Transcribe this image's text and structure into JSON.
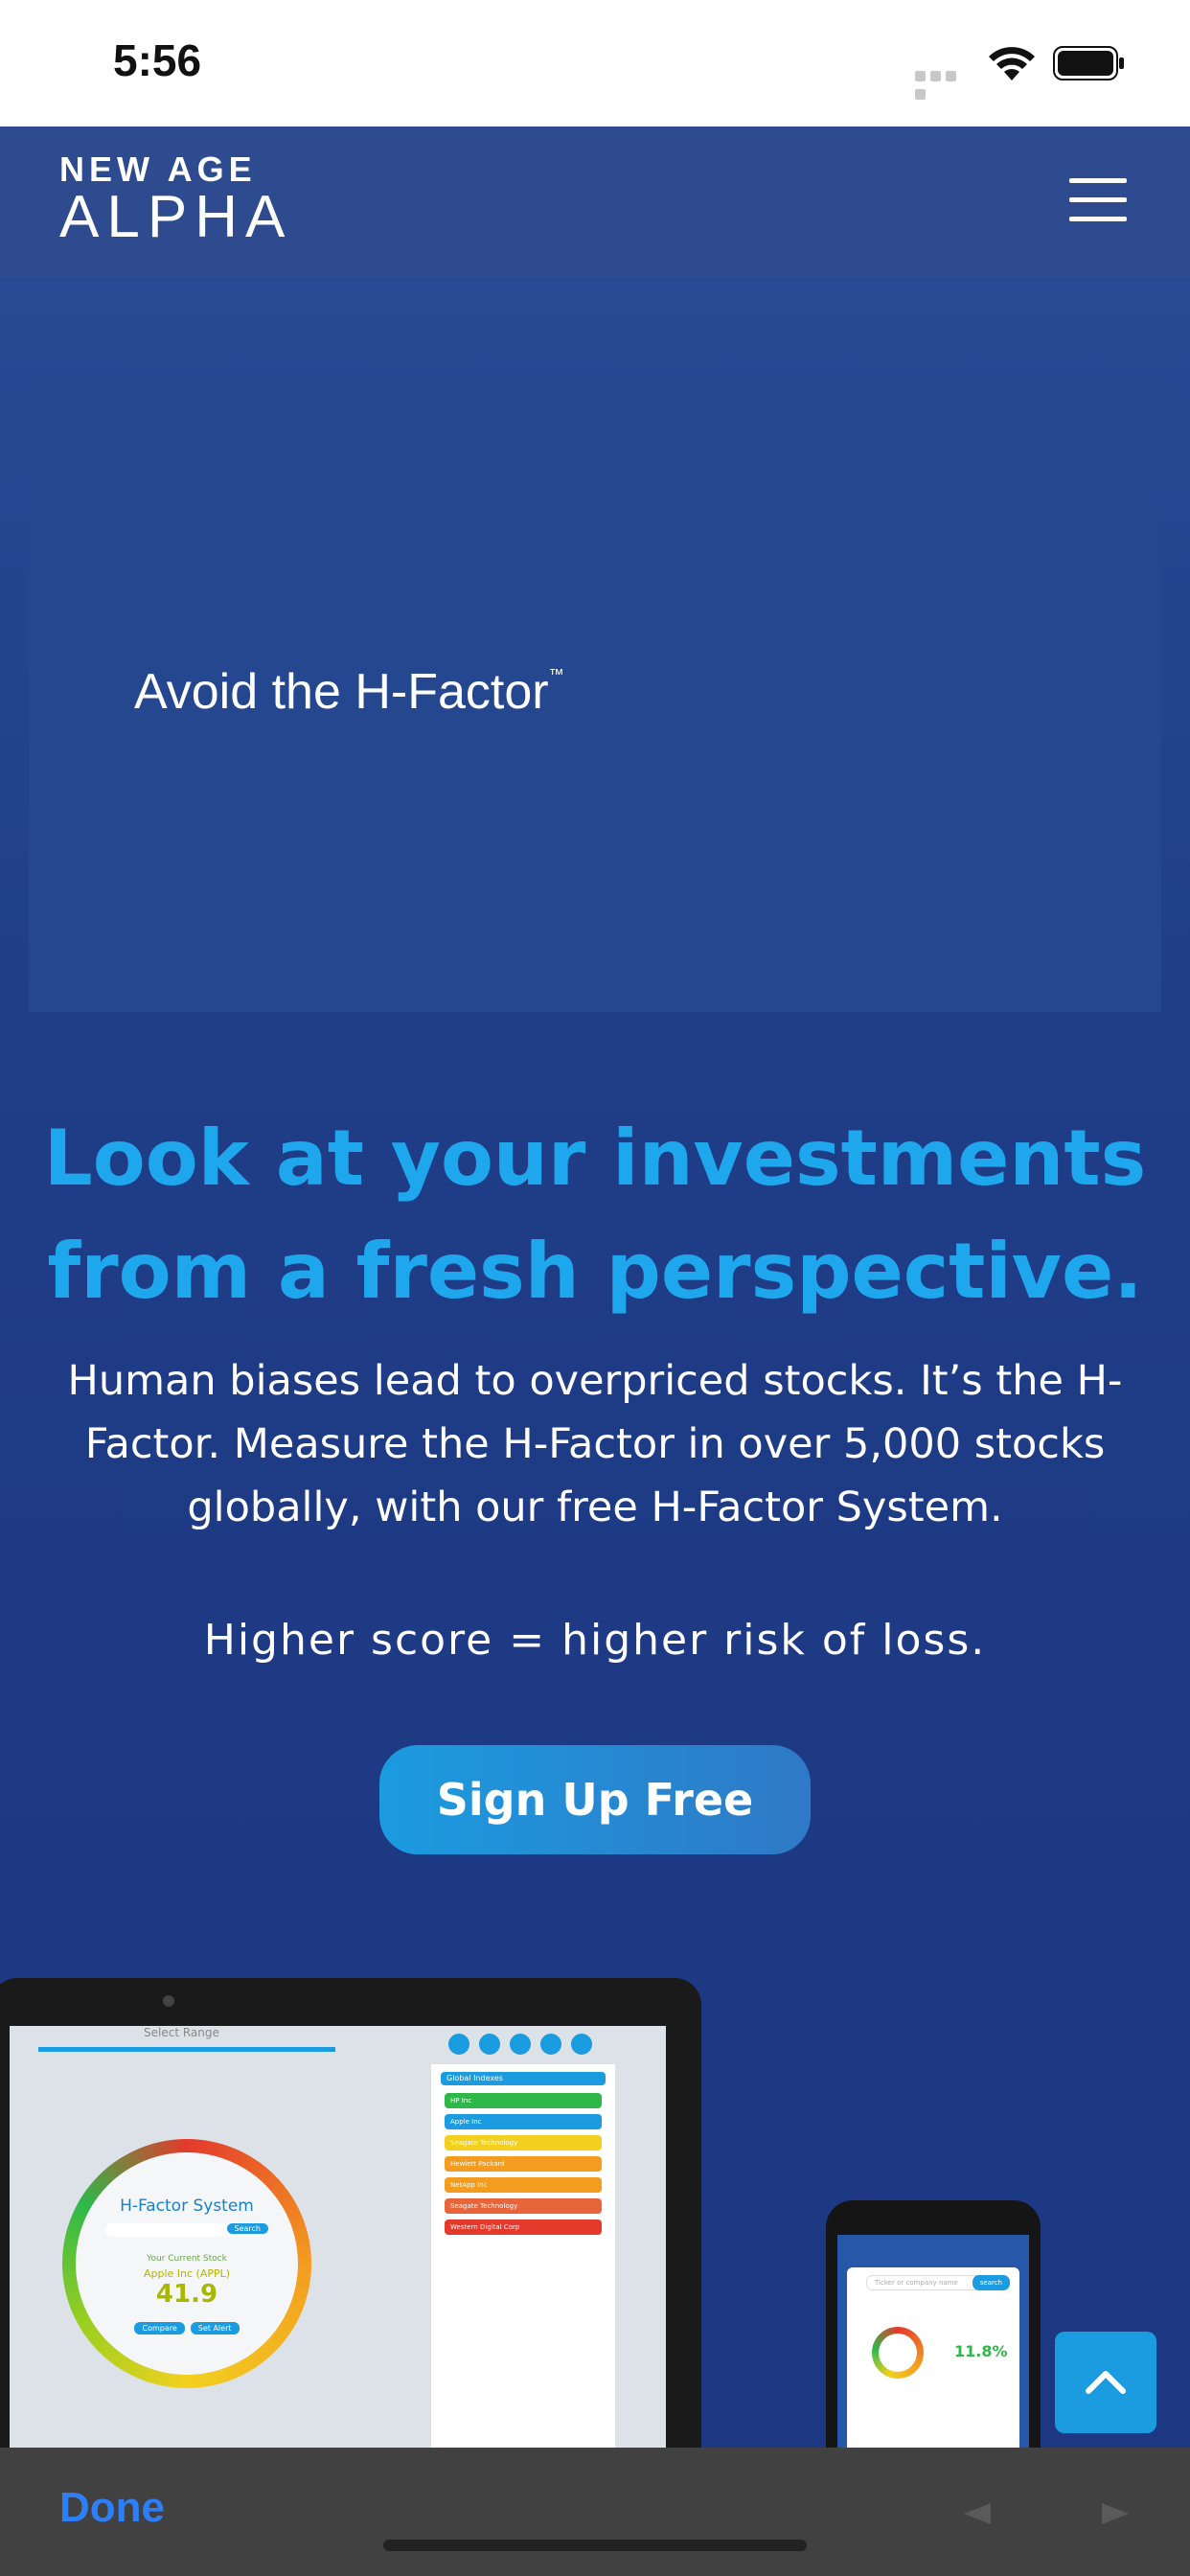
{
  "status_bar": {
    "time": "5:56"
  },
  "header": {
    "logo_line1": "NEW AGE",
    "logo_line2": "ALPHA"
  },
  "hero": {
    "text": "Avoid the H-Factor",
    "trademark": "™"
  },
  "main": {
    "headline_line1": "Look at your investments",
    "headline_line2": "from a fresh perspective.",
    "body": "Human biases lead to overpriced stocks. It’s the H-Factor. Measure the H-Factor in over 5,000 stocks globally, with our free H-Factor System.",
    "risk": "Higher score = higher risk of loss.",
    "cta_label": "Sign Up Free"
  },
  "laptop_mockup": {
    "range_label": "Select Range",
    "dial_title": "H-Factor System",
    "search_button": "Search",
    "current_label": "Your Current Stock",
    "stock_name": "Apple Inc (APPL)",
    "score": "41.9",
    "compare_label": "Compare",
    "alert_label": "Set Alert",
    "panel_header": "Global Indexes",
    "rows": [
      {
        "label": "HP Inc",
        "color": "#2eb84a"
      },
      {
        "label": "Apple Inc",
        "color": "#1b9be0"
      },
      {
        "label": "Seagate Technology",
        "color": "#f3d020"
      },
      {
        "label": "Hewlett Packard",
        "color": "#f39c20"
      },
      {
        "label": "NetApp Inc",
        "color": "#f39c20"
      },
      {
        "label": "Seagate Technology",
        "color": "#e8643a"
      },
      {
        "label": "Western Digital Corp",
        "color": "#e43a2c"
      }
    ]
  },
  "phone_mockup": {
    "search_placeholder": "Ticker or company name",
    "search_button": "search",
    "pct": "11.8%"
  },
  "browser_bar": {
    "done_label": "Done"
  },
  "colors": {
    "accent": "#1fa7ee",
    "background": "#1f3a80",
    "nav": "#2e4b8f"
  }
}
